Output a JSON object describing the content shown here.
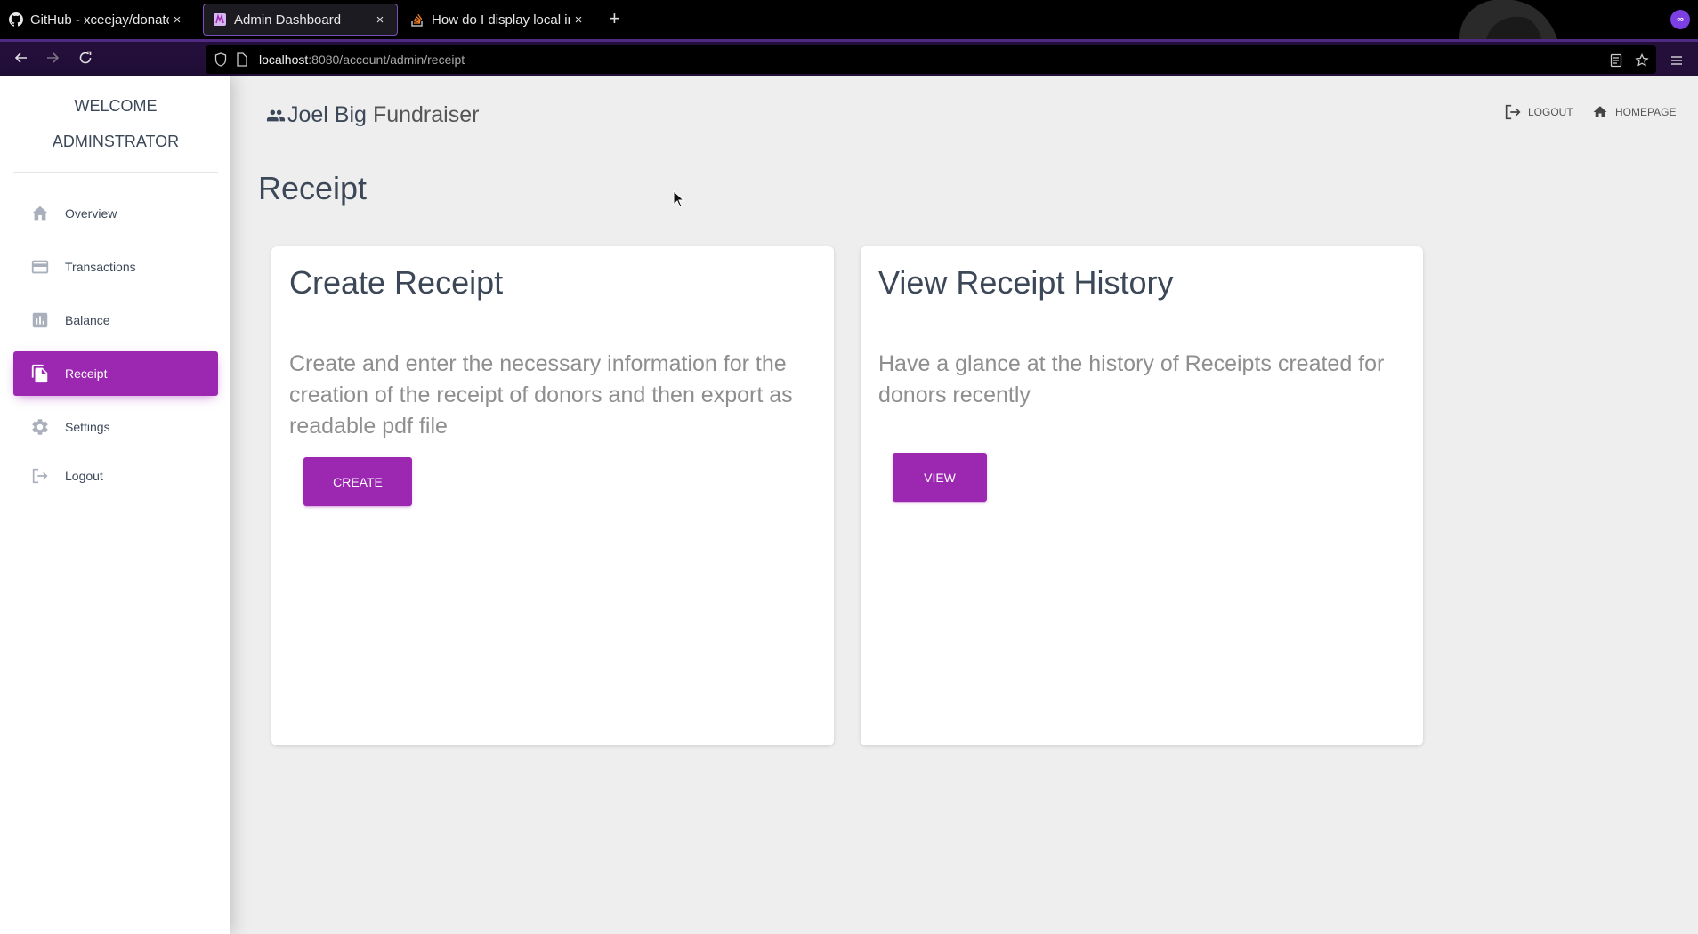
{
  "browser": {
    "tabs": [
      {
        "title": "GitHub - xceejay/donate-pa",
        "icon": "github-icon"
      },
      {
        "title": "Admin Dashboard",
        "icon": "dashboard-favicon",
        "active": true
      },
      {
        "title": "How do I display local image",
        "icon": "stackoverflow-favicon"
      }
    ],
    "new_tab": "+",
    "close_glyph": "×",
    "url": {
      "host": "localhost",
      "path": ":8080/account/admin/receipt"
    },
    "account_badge": "∞"
  },
  "sidebar": {
    "brand_line1": "WELCOME",
    "brand_line2": "ADMINSTRATOR",
    "items": [
      {
        "label": "Overview",
        "icon": "home-icon"
      },
      {
        "label": "Transactions",
        "icon": "credit-card-icon"
      },
      {
        "label": "Balance",
        "icon": "bar-chart-icon"
      },
      {
        "label": "Receipt",
        "icon": "file-copy-icon",
        "active": true
      },
      {
        "label": "Settings",
        "icon": "gear-icon"
      },
      {
        "label": "Logout",
        "icon": "logout-icon"
      }
    ]
  },
  "header": {
    "title_bold": "Joel Big",
    "title_light": "Fundraiser",
    "logout_label": "LOGOUT",
    "homepage_label": "HOMEPAGE"
  },
  "page": {
    "title": "Receipt",
    "cards": [
      {
        "title": "Create Receipt",
        "text": "Create and enter the necessary information for the creation of the receipt of donors and then export as readable pdf file",
        "button": "CREATE"
      },
      {
        "title": "View Receipt History",
        "text": "Have a glance at the history of Receipts created for donors recently",
        "button": "VIEW"
      }
    ]
  },
  "colors": {
    "accent": "#9c27b0",
    "chrome_toolbar": "#230f3a",
    "background": "#eeeeee"
  }
}
